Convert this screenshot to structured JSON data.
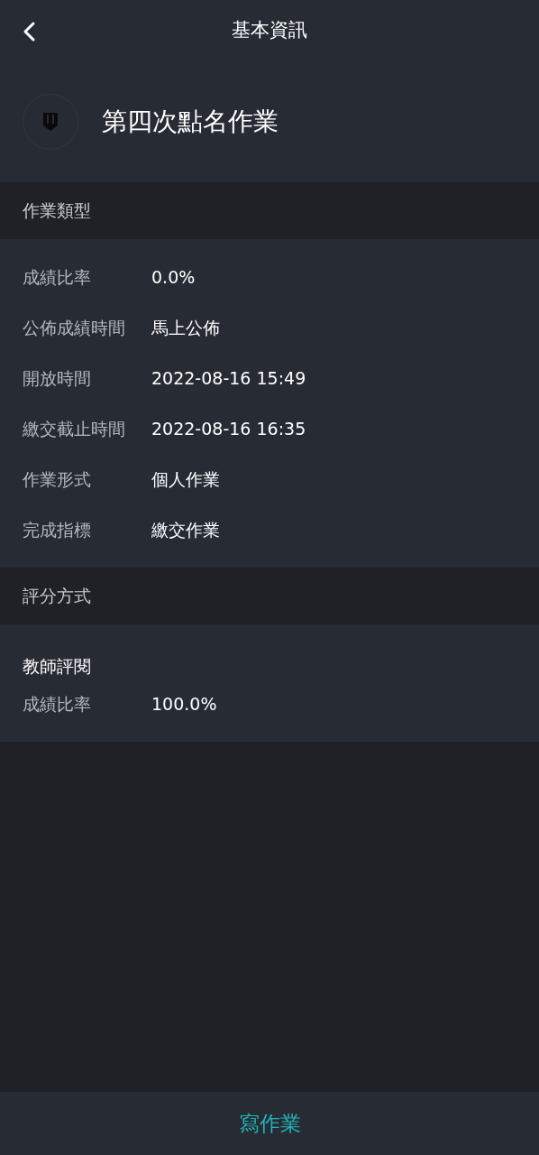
{
  "header": {
    "title": "基本資訊"
  },
  "assignment": {
    "title": "第四次點名作業"
  },
  "sections": [
    {
      "title": "作業類型",
      "rows": [
        {
          "kind": "field",
          "label": "成績比率",
          "value": "0.0%"
        },
        {
          "kind": "field",
          "label": "公佈成績時間",
          "value": "馬上公佈"
        },
        {
          "kind": "field",
          "label": "開放時間",
          "value": "2022-08-16 15:49"
        },
        {
          "kind": "field",
          "label": "繳交截止時間",
          "value": "2022-08-16 16:35"
        },
        {
          "kind": "field",
          "label": "作業形式",
          "value": "個人作業"
        },
        {
          "kind": "field",
          "label": "完成指標",
          "value": "繳交作業"
        }
      ]
    },
    {
      "title": "評分方式",
      "rows": [
        {
          "kind": "heading",
          "label": "教師評閱"
        },
        {
          "kind": "field",
          "label": "成績比率",
          "value": "100.0%"
        }
      ]
    }
  ],
  "action": {
    "label": "寫作業"
  }
}
